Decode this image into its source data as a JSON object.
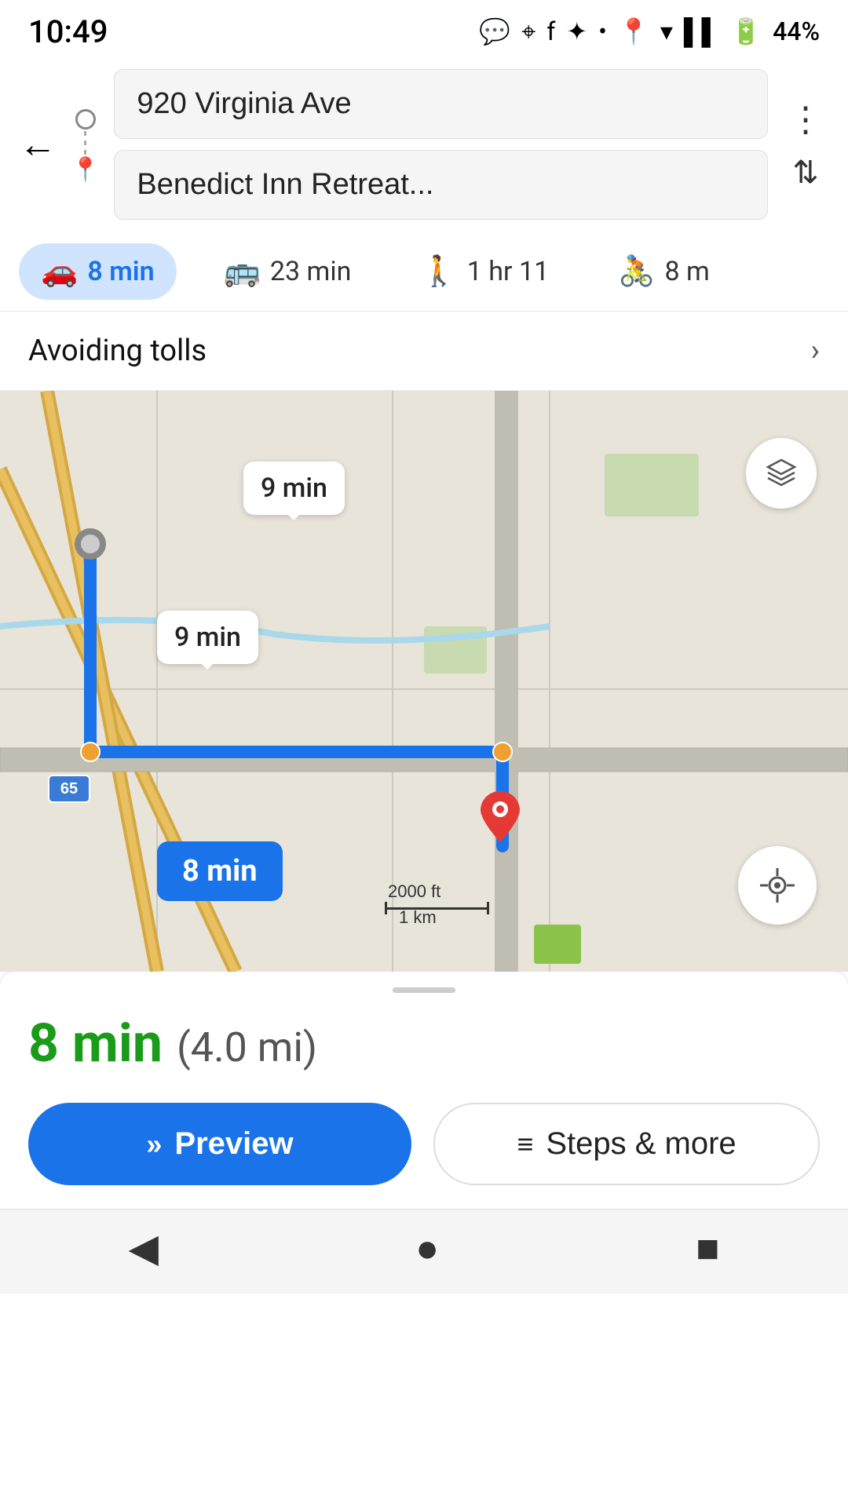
{
  "statusBar": {
    "time": "10:49",
    "battery": "44%"
  },
  "header": {
    "origin": "920 Virginia Ave",
    "destination": "Benedict Inn Retreat...",
    "moreMenuLabel": "⋮",
    "swapLabel": "⇅"
  },
  "transportTabs": [
    {
      "id": "drive",
      "icon": "🚗",
      "label": "8 min",
      "active": true
    },
    {
      "id": "transit",
      "icon": "🚌",
      "label": "23 min",
      "active": false
    },
    {
      "id": "walk",
      "icon": "🚶",
      "label": "1 hr 11",
      "active": false
    },
    {
      "id": "bike",
      "icon": "🚴",
      "label": "8 m",
      "active": false
    }
  ],
  "avoidingRow": {
    "label": "Avoiding tolls"
  },
  "map": {
    "label9minTop": "9 min",
    "label9minMid": "9 min",
    "label8min": "8 min",
    "roadBadge": "65",
    "scaleImperial": "2000 ft",
    "scaleMetric": "1 km",
    "layersIcon": "◈",
    "locateIcon": "⊕"
  },
  "bottomPanel": {
    "routeTime": "8 min",
    "routeDistance": "(4.0 mi)",
    "previewLabel": "Preview",
    "stepsLabel": "Steps & more"
  },
  "navBar": {
    "backIcon": "◀",
    "homeIcon": "●",
    "recentIcon": "■"
  }
}
